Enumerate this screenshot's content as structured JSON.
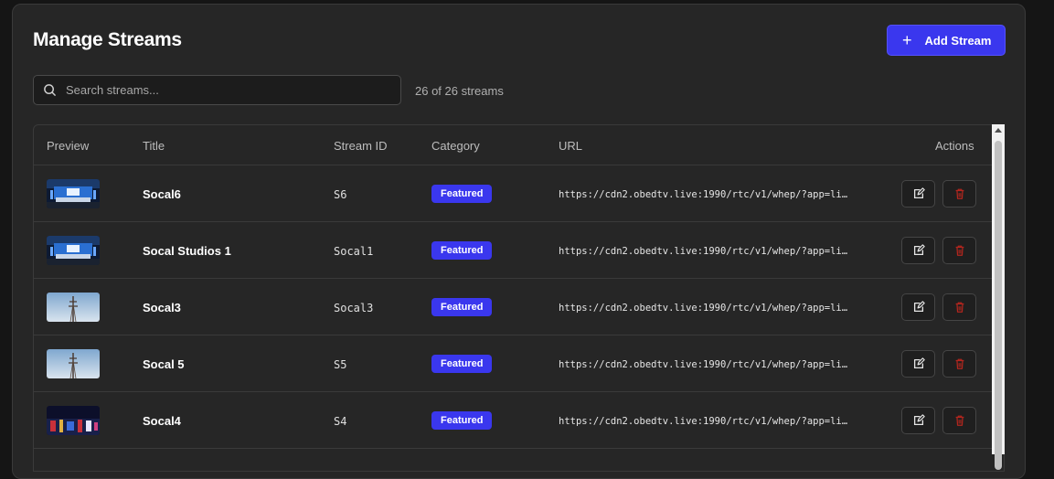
{
  "page": {
    "title": "Manage Streams",
    "add_button_label": "Add Stream",
    "search_placeholder": "Search streams...",
    "count_text": "26 of 26 streams"
  },
  "table": {
    "headers": {
      "preview": "Preview",
      "title": "Title",
      "stream_id": "Stream ID",
      "category": "Category",
      "url": "URL",
      "actions": "Actions"
    },
    "rows": [
      {
        "title": "Socal6",
        "stream_id": "S6",
        "category": "Featured",
        "url": "https://cdn2.obedtv.live:1990/rtc/v1/whep/?app=live&s…",
        "preview": "studio"
      },
      {
        "title": "Socal Studios 1",
        "stream_id": "Socal1",
        "category": "Featured",
        "url": "https://cdn2.obedtv.live:1990/rtc/v1/whep/?app=live&s…",
        "preview": "studio"
      },
      {
        "title": "Socal3",
        "stream_id": "Socal3",
        "category": "Featured",
        "url": "https://cdn2.obedtv.live:1990/rtc/v1/whep/?app=live&s…",
        "preview": "tower"
      },
      {
        "title": "Socal 5",
        "stream_id": "S5",
        "category": "Featured",
        "url": "https://cdn2.obedtv.live:1990/rtc/v1/whep/?app=live&s…",
        "preview": "tower"
      },
      {
        "title": "Socal4",
        "stream_id": "S4",
        "category": "Featured",
        "url": "https://cdn2.obedtv.live:1990/rtc/v1/whep/?app=live&s…",
        "preview": "night"
      }
    ]
  },
  "colors": {
    "accent": "#3a37ee",
    "danger": "#b3261e",
    "panel": "#262626"
  },
  "icons": {
    "search": "search-icon",
    "add": "plus-icon",
    "edit": "edit-icon",
    "delete": "trash-icon"
  }
}
